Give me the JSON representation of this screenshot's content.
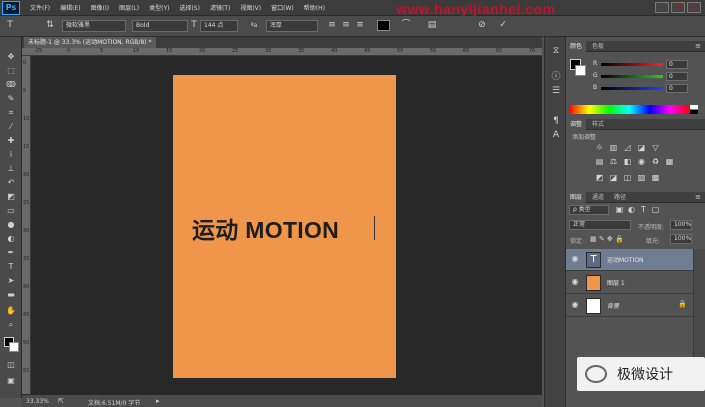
{
  "app": {
    "logo": "Ps"
  },
  "menu": [
    "文件(F)",
    "编辑(E)",
    "图像(I)",
    "图层(L)",
    "类型(Y)",
    "选择(S)",
    "滤镜(T)",
    "视图(V)",
    "窗口(W)",
    "帮助(H)"
  ],
  "watermark": "www.hanyijianhei.com",
  "options": {
    "font_family": "微软雅黑",
    "font_style": "Bold",
    "font_size": "144 点",
    "antialias_prefix": "ªa",
    "antialias": "浑厚",
    "text_color": "#000000"
  },
  "document": {
    "tab_title": "未标题-1 @ 33.3% (运动MOTION, RGB/8) *"
  },
  "rulers": {
    "top": [
      "-25",
      "0",
      "5",
      "10",
      "15",
      "20",
      "25",
      "30",
      "35",
      "40",
      "45",
      "50",
      "55",
      "60",
      "65",
      "70"
    ],
    "left": [
      "0",
      "5",
      "10",
      "15",
      "20",
      "25",
      "30",
      "35",
      "40",
      "45",
      "50",
      "55"
    ]
  },
  "canvas": {
    "background_color": "#f0964a",
    "headline": "运动 MOTION"
  },
  "status": {
    "zoom": "33.33%",
    "doc_size": "文档:6.51M/0 字节"
  },
  "color_panel": {
    "tabs": [
      "颜色",
      "色板"
    ],
    "channels": [
      {
        "label": "R",
        "value": "0",
        "color": "#d23030"
      },
      {
        "label": "G",
        "value": "0",
        "color": "#30b030"
      },
      {
        "label": "B",
        "value": "0",
        "color": "#3040d0"
      }
    ]
  },
  "adjust_panel": {
    "tabs": [
      "调整",
      "样式"
    ],
    "subtitle": "添加调整"
  },
  "layers_panel": {
    "tabs": [
      "图层",
      "通道",
      "路径"
    ],
    "kind_filter": "ρ 类型",
    "blend_mode": "正常",
    "opacity_label": "不透明度:",
    "opacity_value": "100%",
    "lock_label": "锁定:",
    "fill_label": "填充:",
    "fill_value": "100%",
    "layers": [
      {
        "name": "运动MOTION",
        "type": "text",
        "selected": true
      },
      {
        "name": "图层 1",
        "type": "fill",
        "thumb_color": "#f0964a",
        "selected": false
      },
      {
        "name": "背景",
        "type": "background",
        "thumb_color": "#ffffff",
        "selected": false,
        "locked": true
      }
    ]
  },
  "credit": "极微设计"
}
